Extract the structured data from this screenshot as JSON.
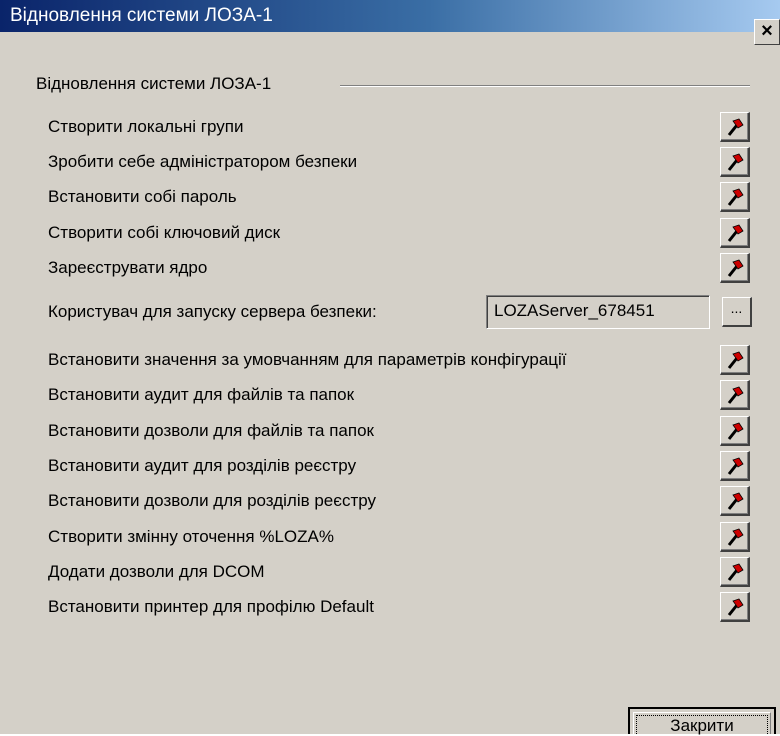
{
  "window": {
    "title": "Відновлення системи ЛОЗА-1",
    "close_glyph": "×"
  },
  "group": {
    "caption": "Відновлення системи ЛОЗА-1"
  },
  "actions_top": [
    {
      "label": "Створити локальні групи"
    },
    {
      "label": "Зробити себе адміністратором безпеки"
    },
    {
      "label": "Встановити собі пароль"
    },
    {
      "label": "Створити собі ключовий диск"
    },
    {
      "label": "Зареєструвати ядро"
    }
  ],
  "server_user": {
    "label": "Користувач для запуску сервера безпеки:",
    "value": "LOZAServer_678451",
    "browse_label": "..."
  },
  "actions_bottom": [
    {
      "label": "Встановити значення за умовчанням для параметрів конфігурації"
    },
    {
      "label": "Встановити аудит для файлів та папок"
    },
    {
      "label": "Встановити дозволи для файлів та папок"
    },
    {
      "label": "Встановити аудит для розділів реєстру"
    },
    {
      "label": "Встановити дозволи для розділів реєстру"
    },
    {
      "label": "Створити змінну оточення %LOZA%"
    },
    {
      "label": "Додати дозволи для DCOM"
    },
    {
      "label": "Встановити принтер для профілю Default"
    }
  ],
  "footer": {
    "close_label": "Закрити"
  },
  "icons": {
    "action": "hammer-icon"
  },
  "colors": {
    "titlebar_start": "#0a246a",
    "titlebar_end": "#a6caf0",
    "face": "#d4d0c8",
    "icon_red": "#cc0000"
  }
}
